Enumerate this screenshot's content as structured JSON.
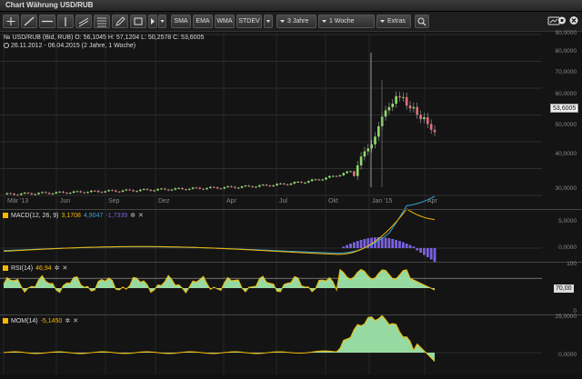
{
  "window": {
    "title": "Chart Währung USD/RUB"
  },
  "toolbar": {
    "indicators": [
      "SMA",
      "EMA",
      "WMA",
      "STDEV"
    ],
    "period": "3 Jahre",
    "interval": "1 Woche",
    "extras": "Extras"
  },
  "main": {
    "symbol_line": "USD/RUB (Bid, RUB)   O: 56,1045   H: 57,1204   L: 50,2578   C: 53,6005",
    "symbol_prefix": "№",
    "range_line": "26.11.2012 - 06.04.2015 (2 Jahre, 1 Woche)",
    "last_price": "53,6005",
    "y_ticks": [
      "90,0000",
      "80,0000",
      "70,0000",
      "60,0000",
      "50,0000",
      "40,0000",
      "30,0000"
    ],
    "x_ticks": [
      "Mär '13",
      "Jun",
      "Sep",
      "Dez",
      "Apr",
      "Jul",
      "Okt",
      "Jan '15",
      "Apr"
    ]
  },
  "macd": {
    "label": "MACD(12, 26, 9)",
    "v1": "3,1708",
    "v2": "4,9047",
    "v3": "-1,7339",
    "y_ticks": [
      "5,0000",
      "0,0000"
    ],
    "colors": {
      "macd": "#f5b800",
      "signal": "#35a3d8",
      "hist": "#7a62e0"
    }
  },
  "rsi": {
    "label": "RSI(14)",
    "value": "46,94",
    "y_ticks": [
      "100",
      "0"
    ],
    "ref_level": "70,00",
    "colors": {
      "line": "#f5b800",
      "fill": "#a5efb0"
    }
  },
  "mom": {
    "label": "MOM(14)",
    "value": "-5,1450",
    "y_ticks": [
      "25,0000",
      "0,0000"
    ],
    "colors": {
      "line": "#f5b800",
      "fill": "#a5efb0"
    }
  },
  "colors": {
    "up": "#8fdc6a",
    "down": "#e2707a",
    "grid": "#2e2e2e"
  }
}
